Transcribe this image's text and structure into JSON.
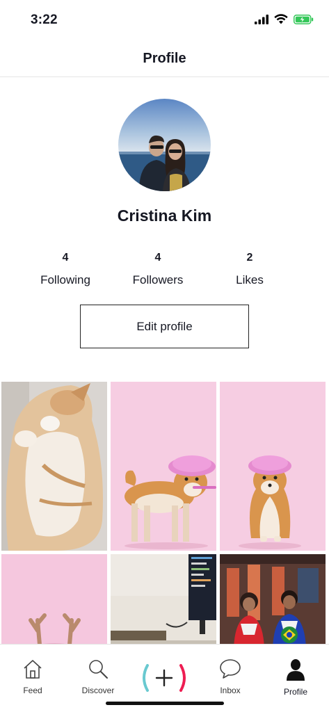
{
  "status_bar": {
    "time": "3:22"
  },
  "header": {
    "title": "Profile"
  },
  "profile": {
    "name": "Cristina Kim",
    "stats": [
      {
        "count": "4",
        "label": "Following"
      },
      {
        "count": "4",
        "label": "Followers"
      },
      {
        "count": "2",
        "label": "Likes"
      }
    ],
    "edit_label": "Edit profile"
  },
  "videos": [
    {
      "subject": "sleeping cat",
      "bg": "#d8d4cf"
    },
    {
      "subject": "shiba with shower cap and toothbrush",
      "bg": "#f5c9df"
    },
    {
      "subject": "shiba with shower cap sitting",
      "bg": "#f5c9df"
    },
    {
      "subject": "antlers on pink",
      "bg": "#f3c5dc"
    },
    {
      "subject": "monitor with code on desk",
      "bg": "#e8e3dc"
    },
    {
      "subject": "two people in ranger costumes",
      "bg": "#6b4a3f"
    }
  ],
  "tab_bar": {
    "items": [
      {
        "label": "Feed",
        "icon": "home-icon"
      },
      {
        "label": "Discover",
        "icon": "search-icon"
      },
      {
        "label": "",
        "icon": "plus-icon"
      },
      {
        "label": "Inbox",
        "icon": "chat-bubble-icon"
      },
      {
        "label": "Profile",
        "icon": "person-icon"
      }
    ],
    "active": "Profile"
  },
  "colors": {
    "accent_cyan": "#69c9d0",
    "accent_red": "#ee1d52",
    "battery_green": "#34c759"
  }
}
